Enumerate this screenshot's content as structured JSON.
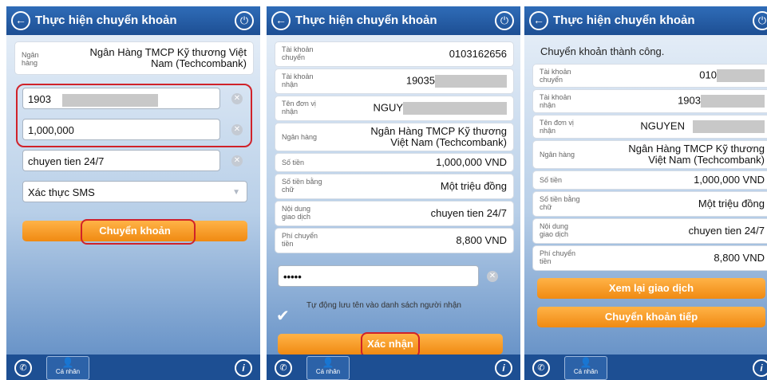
{
  "header": {
    "title": "Thực hiện chuyển khoản",
    "back_icon": "arrow-left-icon",
    "power_icon": "power-icon"
  },
  "footer": {
    "personal_label": "Cá nhân"
  },
  "screen1": {
    "bank_label": "Ngân hàng",
    "bank_value": "Ngân Hàng TMCP Kỹ thương Việt Nam (Techcombank)",
    "account_value": "1903",
    "amount_value": "1,000,000",
    "content_value": "chuyen tien 24/7",
    "auth_value": "Xác thực SMS",
    "transfer_button": "Chuyển khoản"
  },
  "screen2": {
    "rows": [
      {
        "label": "Tài khoản chuyển",
        "value": "0103162656"
      },
      {
        "label": "Tài khoản nhận",
        "value": "19035"
      },
      {
        "label": "Tên đơn vị nhận",
        "value": "NGUY"
      },
      {
        "label": "Ngân hàng",
        "value": "Ngân Hàng TMCP Kỹ thương Việt Nam (Techcombank)"
      },
      {
        "label": "Số tiền",
        "value": "1,000,000 VND"
      },
      {
        "label": "Số tiền bằng chữ",
        "value": "Một triệu đồng"
      },
      {
        "label": "Nội dung giao dịch",
        "value": "chuyen tien 24/7"
      },
      {
        "label": "Phí chuyển tiền",
        "value": "8,800 VND"
      }
    ],
    "otp_value": "•••••",
    "auto_save_text": "Tự động lưu tên vào danh sách người nhận",
    "confirm_button": "Xác nhận"
  },
  "screen3": {
    "success_text": "Chuyển khoản thành công.",
    "rows": [
      {
        "label": "Tài khoản chuyển",
        "value": "010"
      },
      {
        "label": "Tài khoản nhận",
        "value": "1903"
      },
      {
        "label": "Tên đơn vị nhận",
        "value": "NGUYEN"
      },
      {
        "label": "Ngân hàng",
        "value": "Ngân Hàng TMCP Kỹ thương Việt Nam (Techcombank)"
      },
      {
        "label": "Số tiền",
        "value": "1,000,000 VND"
      },
      {
        "label": "Số tiền bằng chữ",
        "value": "Một triệu đồng"
      },
      {
        "label": "Nội dung giao dịch",
        "value": "chuyen tien 24/7"
      },
      {
        "label": "Phí chuyển tiền",
        "value": "8,800 VND"
      }
    ],
    "review_button": "Xem lại giao dịch",
    "continue_button": "Chuyển khoản tiếp"
  },
  "colors": {
    "header_blue": "#1d4f93",
    "button_orange": "#f08a12",
    "highlight_red": "#d0222a"
  }
}
